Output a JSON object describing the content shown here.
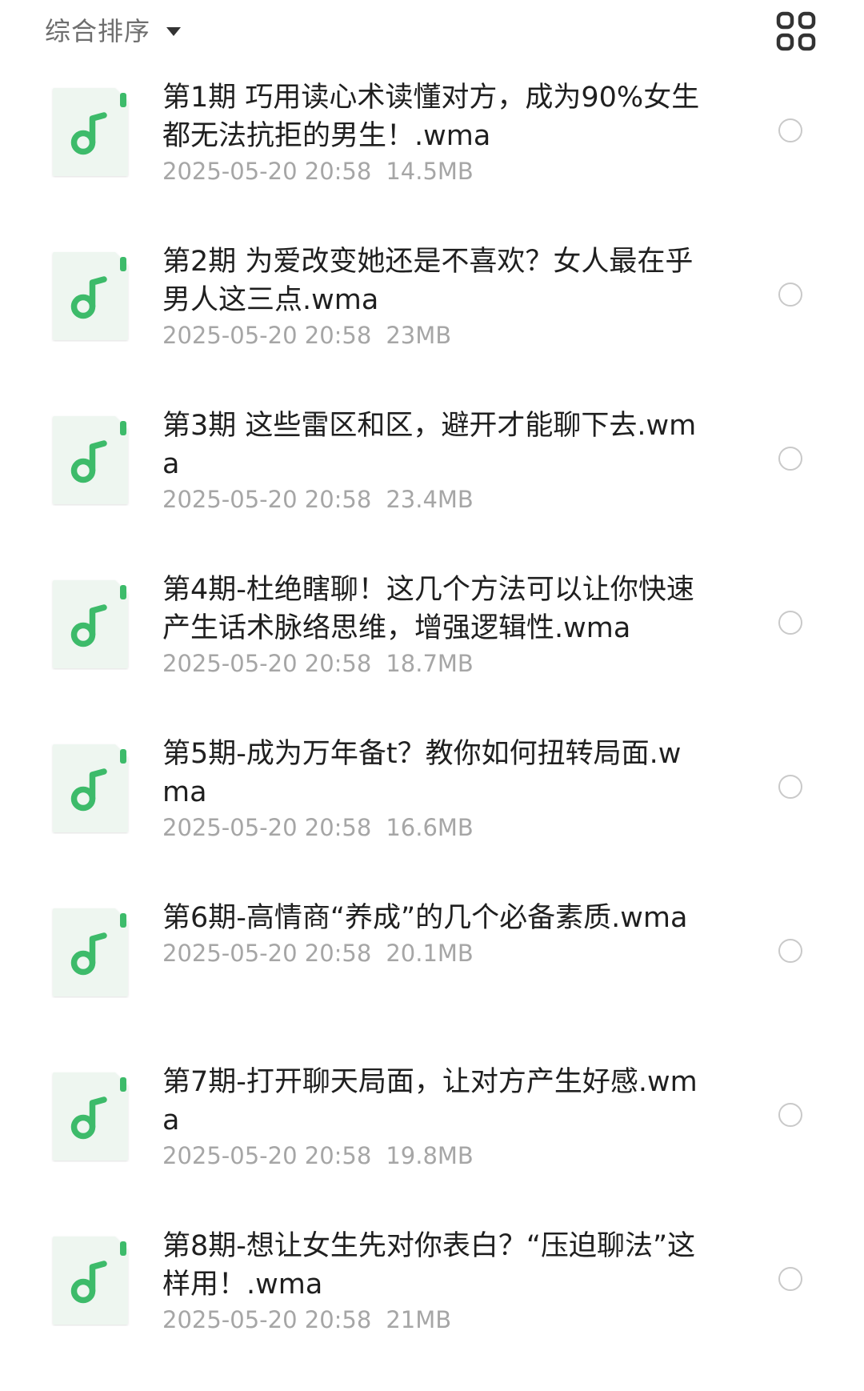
{
  "toolbar": {
    "sort_label": "综合排序",
    "sort_icon": "caret-down-icon",
    "view_toggle_icon": "grid-view-icon"
  },
  "colors": {
    "accent": "#3dbb6a",
    "icon_bg": "#eef6f0",
    "meta_text": "#a6a6a6",
    "radio_border": "#c9c9c9"
  },
  "files": [
    {
      "title": "第1期 巧用读心术读懂对方，成为90%女生都无法抗拒的男生！.wma",
      "date": "2025-05-20 20:58",
      "size": "14.5MB",
      "icon": "music-note-icon"
    },
    {
      "title": "第2期 为爱改变她还是不喜欢？女人最在乎男人这三点.wma",
      "date": "2025-05-20 20:58",
      "size": "23MB",
      "icon": "music-note-icon"
    },
    {
      "title": "第3期 这些雷区和区，避开才能聊下去.wma",
      "date": "2025-05-20 20:58",
      "size": "23.4MB",
      "icon": "music-note-icon"
    },
    {
      "title": "第4期-杜绝瞎聊！这几个方法可以让你快速产生话术脉络思维，增强逻辑性.wma",
      "date": "2025-05-20 20:58",
      "size": "18.7MB",
      "icon": "music-note-icon"
    },
    {
      "title": "第5期-成为万年备t？教你如何扭转局面.wma",
      "date": "2025-05-20 20:58",
      "size": "16.6MB",
      "icon": "music-note-icon"
    },
    {
      "title": "第6期-高情商“养成”的几个必备素质.wma",
      "date": "2025-05-20 20:58",
      "size": "20.1MB",
      "icon": "music-note-icon"
    },
    {
      "title": "第7期-打开聊天局面，让对方产生好感.wma",
      "date": "2025-05-20 20:58",
      "size": "19.8MB",
      "icon": "music-note-icon"
    },
    {
      "title": "第8期-想让女生先对你表白？“压迫聊法”这样用！.wma",
      "date": "2025-05-20 20:58",
      "size": "21MB",
      "icon": "music-note-icon"
    }
  ]
}
